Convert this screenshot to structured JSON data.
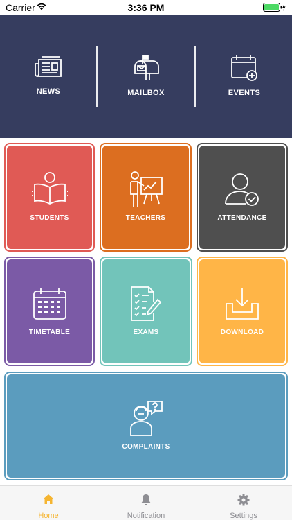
{
  "status_bar": {
    "carrier": "Carrier",
    "time": "3:36 PM"
  },
  "header": {
    "items": [
      {
        "label": "NEWS",
        "icon": "newspaper-icon"
      },
      {
        "label": "MAILBOX",
        "icon": "mailbox-icon"
      },
      {
        "label": "EVENTS",
        "icon": "calendar-add-icon"
      }
    ],
    "background": "#363d5f"
  },
  "tiles": [
    {
      "label": "STUDENTS",
      "icon": "student-reading-icon",
      "color": "#e05a55"
    },
    {
      "label": "TEACHERS",
      "icon": "teacher-board-icon",
      "color": "#dc6e20"
    },
    {
      "label": "ATTENDANCE",
      "icon": "user-check-icon",
      "color": "#4f4f4f"
    },
    {
      "label": "TIMETABLE",
      "icon": "calendar-grid-icon",
      "color": "#7b5aa6"
    },
    {
      "label": "EXAMS",
      "icon": "checklist-icon",
      "color": "#72c4ba"
    },
    {
      "label": "DOWNLOAD",
      "icon": "download-tray-icon",
      "color": "#ffb547"
    },
    {
      "label": "COMPLAINTS",
      "icon": "question-person-icon",
      "color": "#5b9cbe"
    }
  ],
  "tab_bar": {
    "tabs": [
      {
        "label": "Home",
        "icon": "home-icon",
        "active": true
      },
      {
        "label": "Notification",
        "icon": "bell-icon",
        "active": false
      },
      {
        "label": "Settings",
        "icon": "gear-icon",
        "active": false
      }
    ],
    "active_color": "#f5b531",
    "inactive_color": "#8e8e93"
  }
}
